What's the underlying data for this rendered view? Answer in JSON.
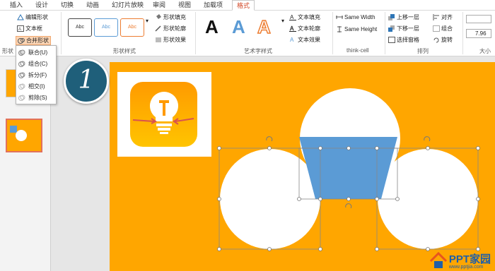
{
  "tabs": [
    "插入",
    "设计",
    "切换",
    "动画",
    "幻灯片放映",
    "审阅",
    "视图",
    "加载项",
    "格式"
  ],
  "active_tab": "格式",
  "ribbon": {
    "insert_shapes": {
      "edit_shape": "编辑形状",
      "text_box": "文本框",
      "merge_shapes": "合并形状",
      "group_label": "形状"
    },
    "shape_styles": {
      "label": "形状样式",
      "style_sample": "Abc",
      "fill": "形状填充",
      "outline": "形状轮廓",
      "effects": "形状效果"
    },
    "wordart": {
      "label": "艺术字样式",
      "sample": "A",
      "text_fill": "文本填充",
      "text_outline": "文本轮廓",
      "text_effects": "文本效果"
    },
    "thinkcell": {
      "label": "think-cell",
      "same_width": "Same Width",
      "same_height": "Same Height"
    },
    "arrange": {
      "label": "排列",
      "bring_forward": "上移一层",
      "send_backward": "下移一层",
      "selection_pane": "选择窗格",
      "align": "对齐",
      "group": "组合",
      "rotate": "旋转"
    },
    "size": {
      "label": "大小",
      "width_value": "7.96"
    }
  },
  "merge_menu": {
    "items": [
      "联合(U)",
      "组合(C)",
      "拆分(F)",
      "相交(I)",
      "剪除(S)"
    ]
  },
  "badge": "1",
  "logo": {
    "text": "PPT家园",
    "url": "www.pptjia.com"
  },
  "colors": {
    "slide_bg": "#ffa600",
    "trapezoid": "#5b9bd5",
    "badge": "#1f5f7a",
    "active_tab": "#d24726"
  }
}
